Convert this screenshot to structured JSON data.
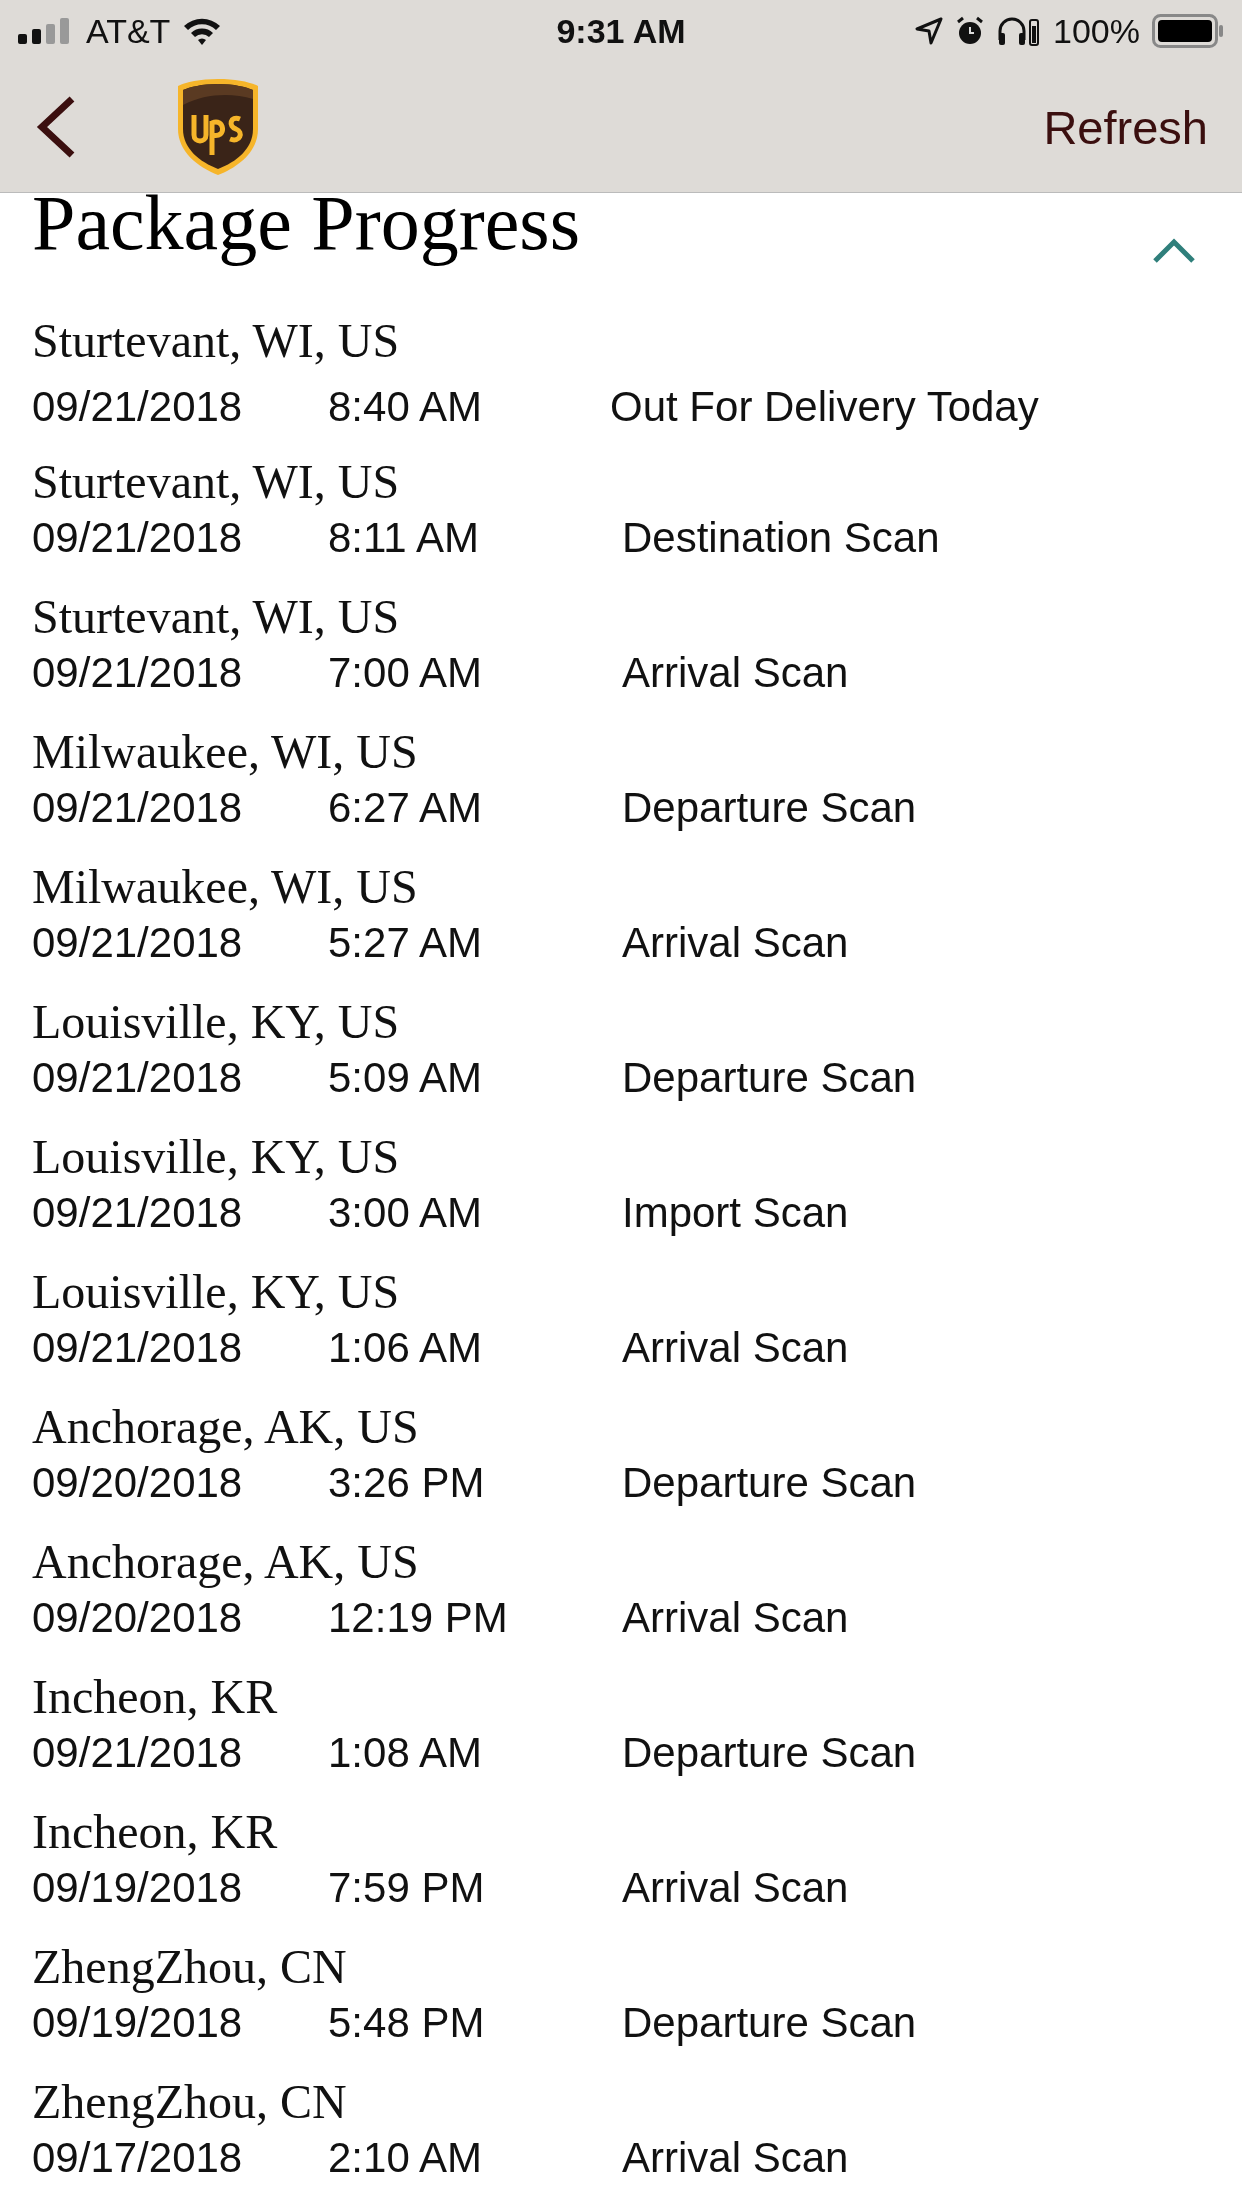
{
  "status_bar": {
    "carrier": "AT&T",
    "time": "9:31 AM",
    "battery": "100%"
  },
  "nav": {
    "action": "Refresh"
  },
  "section": {
    "title": "Package Progress",
    "expanded": true
  },
  "events": [
    {
      "location": "Sturtevant, WI, US",
      "date": "09/21/2018",
      "time": "8:40 AM",
      "status": "Out For Delivery Today"
    },
    {
      "location": "Sturtevant, WI, US",
      "date": "09/21/2018",
      "time": "8:11 AM",
      "status": "Destination Scan"
    },
    {
      "location": "Sturtevant, WI, US",
      "date": "09/21/2018",
      "time": "7:00 AM",
      "status": "Arrival Scan"
    },
    {
      "location": "Milwaukee, WI, US",
      "date": "09/21/2018",
      "time": "6:27 AM",
      "status": "Departure Scan"
    },
    {
      "location": "Milwaukee, WI, US",
      "date": "09/21/2018",
      "time": "5:27 AM",
      "status": "Arrival Scan"
    },
    {
      "location": "Louisville, KY, US",
      "date": "09/21/2018",
      "time": "5:09 AM",
      "status": "Departure Scan"
    },
    {
      "location": "Louisville, KY, US",
      "date": "09/21/2018",
      "time": "3:00 AM",
      "status": "Import Scan"
    },
    {
      "location": "Louisville, KY, US",
      "date": "09/21/2018",
      "time": "1:06 AM",
      "status": "Arrival Scan"
    },
    {
      "location": "Anchorage, AK, US",
      "date": "09/20/2018",
      "time": "3:26 PM",
      "status": "Departure Scan"
    },
    {
      "location": "Anchorage, AK, US",
      "date": "09/20/2018",
      "time": "12:19 PM",
      "status": "Arrival Scan"
    },
    {
      "location": "Incheon, KR",
      "date": "09/21/2018",
      "time": "1:08 AM",
      "status": "Departure Scan"
    },
    {
      "location": "Incheon, KR",
      "date": "09/19/2018",
      "time": "7:59 PM",
      "status": "Arrival Scan"
    },
    {
      "location": "ZhengZhou, CN",
      "date": "09/19/2018",
      "time": "5:48 PM",
      "status": "Departure Scan"
    },
    {
      "location": "ZhengZhou, CN",
      "date": "09/17/2018",
      "time": "2:10 AM",
      "status": "Arrival Scan"
    }
  ]
}
